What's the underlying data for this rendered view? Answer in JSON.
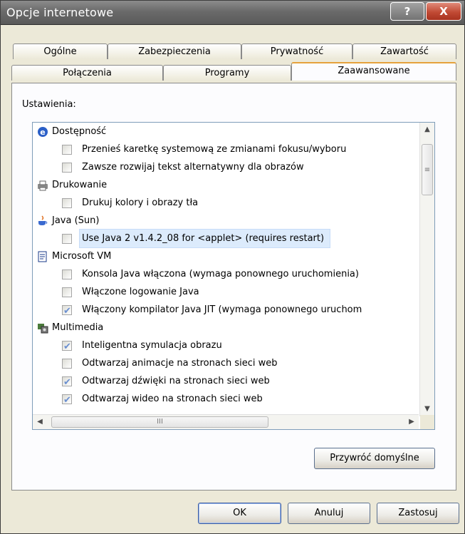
{
  "window": {
    "title": "Opcje internetowe",
    "help_label": "?",
    "close_label": "X"
  },
  "tabs_row1": [
    "Ogólne",
    "Zabezpieczenia",
    "Prywatność",
    "Zawartość"
  ],
  "tabs_row2": [
    "Połączenia",
    "Programy",
    "Zaawansowane"
  ],
  "active_tab": "Zaawansowane",
  "settings_label": "Ustawienia:",
  "tree": [
    {
      "type": "category",
      "label": "Dostępność",
      "icon": "accessibility-icon"
    },
    {
      "type": "item",
      "label": "Przenieś karetkę systemową ze zmianami fokusu/wyboru",
      "checked": false
    },
    {
      "type": "item",
      "label": "Zawsze rozwijaj tekst alternatywny dla obrazów",
      "checked": false
    },
    {
      "type": "category",
      "label": "Drukowanie",
      "icon": "printer-icon"
    },
    {
      "type": "item",
      "label": "Drukuj kolory i obrazy tła",
      "checked": false
    },
    {
      "type": "category",
      "label": "Java (Sun)",
      "icon": "java-cup-icon"
    },
    {
      "type": "item",
      "label": "Use Java 2 v1.4.2_08 for <applet> (requires restart)",
      "checked": false,
      "selected": true
    },
    {
      "type": "category",
      "label": "Microsoft VM",
      "icon": "document-icon"
    },
    {
      "type": "item",
      "label": "Konsola Java włączona (wymaga ponownego uruchomienia)",
      "checked": false
    },
    {
      "type": "item",
      "label": "Włączone logowanie Java",
      "checked": false
    },
    {
      "type": "item",
      "label": "Włączony kompilator Java JIT (wymaga ponownego uruchom",
      "checked": true
    },
    {
      "type": "category",
      "label": "Multimedia",
      "icon": "multimedia-icon"
    },
    {
      "type": "item",
      "label": "Inteligentna symulacja obrazu",
      "checked": true
    },
    {
      "type": "item",
      "label": "Odtwarzaj animacje na stronach sieci web",
      "checked": false
    },
    {
      "type": "item",
      "label": "Odtwarzaj dźwięki na stronach sieci web",
      "checked": true
    },
    {
      "type": "item",
      "label": "Odtwarzaj wideo na stronach sieci web",
      "checked": true
    }
  ],
  "scroll": {
    "thumb_grip": "≡",
    "h_thumb_grip": "III"
  },
  "buttons": {
    "restore_defaults": "Przywróć domyślne",
    "ok": "OK",
    "cancel": "Anuluj",
    "apply": "Zastosuj"
  }
}
